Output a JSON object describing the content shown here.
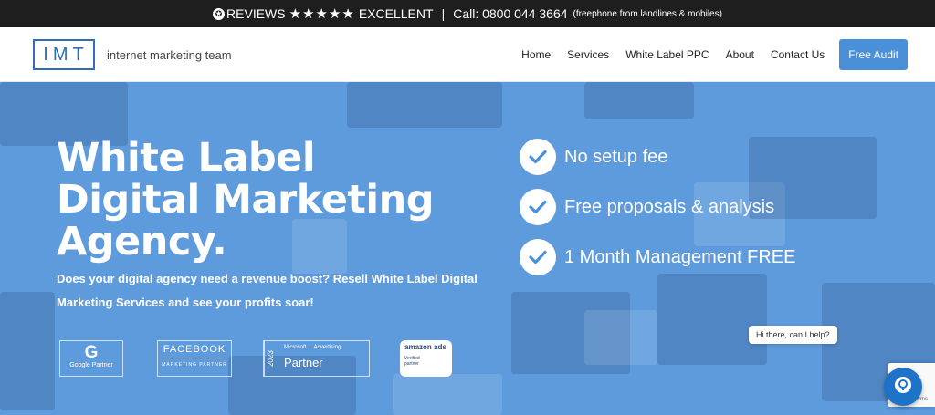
{
  "topbar": {
    "reviews_label": "REVIEWS",
    "stars": "★★★★★",
    "rating": "EXCELLENT",
    "separator": "|",
    "phone": "Call: 0800 044 3664",
    "phone_note": "(freephone from landlines & mobiles)"
  },
  "header": {
    "logo": "IMT",
    "logo_text": "internet marketing team",
    "nav": [
      "Home",
      "Services",
      "White Label PPC",
      "About",
      "Contact Us"
    ],
    "cta": "Free Audit"
  },
  "hero": {
    "headline": [
      "White Label",
      "Digital Marketing",
      "Agency."
    ],
    "subline": "Does your digital agency need a revenue boost? Resell White Label Digital Marketing Services and see your profits soar!",
    "checks": [
      "No setup fee",
      "Free proposals & analysis",
      "1 Month Management FREE"
    ]
  },
  "badges": {
    "google": {
      "mark": "G",
      "label": "Google Partner"
    },
    "facebook": {
      "title": "FACEBOOK",
      "sub": "MARKETING PARTNER"
    },
    "microsoft": {
      "year": "2023",
      "brand": "Microsoft",
      "program": "Advertising",
      "label": "Partner"
    },
    "amazon": {
      "title": "amazon ads",
      "line1": "Verified",
      "line2": "partner"
    }
  },
  "chat": {
    "bubble": "Hi there, can I help?",
    "terms": "Terms"
  },
  "colors": {
    "topbar_bg": "#1e1e1e",
    "brand_blue": "#2f6fb8",
    "cta_blue": "#4a90d9",
    "hero_overlay": "#5e9bdc"
  },
  "icons": [
    "review-star-badge-icon",
    "google-g-icon",
    "check-icon",
    "chat-icon"
  ]
}
